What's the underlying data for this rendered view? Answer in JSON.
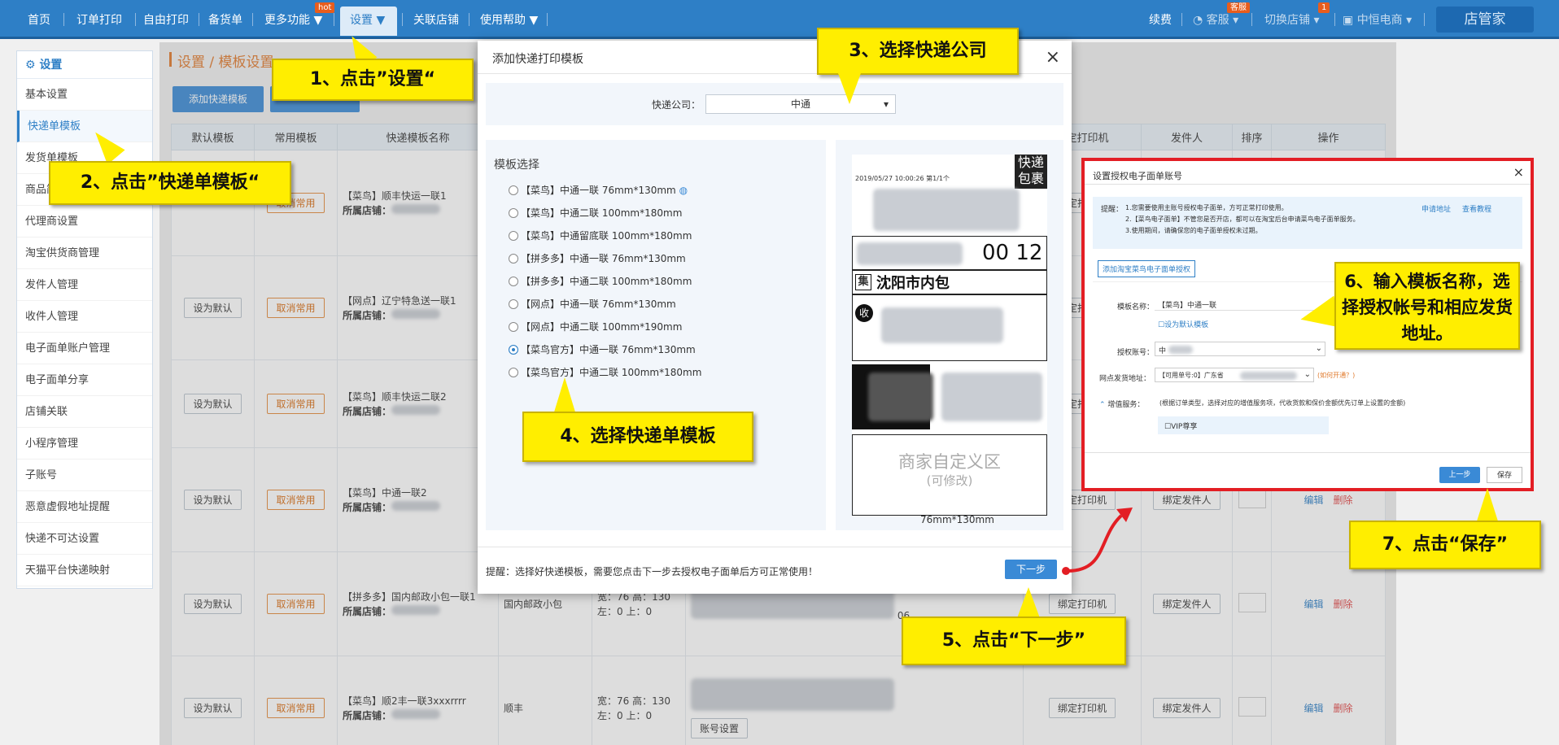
{
  "nav": {
    "items": [
      "首页",
      "订单打印",
      "自由打印",
      "备货单",
      "更多功能 ▼",
      "设置 ▼",
      "关联店铺",
      "使用帮助 ▼"
    ],
    "hot_badge": "hot",
    "right": {
      "renew": "续费",
      "service": "客服",
      "service_badge": "客服",
      "switch_shop": "切换店铺",
      "switch_badge": "1",
      "company": "中恒电商"
    },
    "logo": "店管家"
  },
  "sidebar": {
    "title": "设置",
    "items": [
      "基本设置",
      "快递单模板",
      "发货单模板",
      "商品简称",
      "代理商设置",
      "淘宝供货商管理",
      "发件人管理",
      "收件人管理",
      "电子面单账户管理",
      "电子面单分享",
      "店铺关联",
      "小程序管理",
      "子账号",
      "恶意虚假地址提醒",
      "快递不可达设置",
      "天猫平台快递映射"
    ]
  },
  "main": {
    "crumb": "设置 / 模板设置",
    "add_button": "添加快递模板",
    "table": {
      "headers": [
        "默认模板",
        "常用模板",
        "快递模板名称",
        "",
        "",
        "",
        "绑定打印机",
        "发件人",
        "排序",
        "操作"
      ],
      "shop_label": "所属店铺：",
      "rows": [
        {
          "default": "",
          "common": "取消常用",
          "name": "【菜鸟】顺丰快运一联1",
          "company": "",
          "size": "",
          "bind": ""
        },
        {
          "default": "设为默认",
          "common": "取消常用",
          "name": "【网点】辽宁特急送一联1",
          "company": "",
          "size": "",
          "bind": ""
        },
        {
          "default": "设为默认",
          "common": "取消常用",
          "name": "【菜鸟】顺丰快运二联2",
          "company": "",
          "size": "",
          "bind": ""
        },
        {
          "default": "设为默认",
          "common": "取消常用",
          "name": "【菜鸟】中通一联2",
          "company": "",
          "size": "",
          "bind": ""
        },
        {
          "default": "设为默认",
          "common": "取消常用",
          "name": "【拼多多】国内邮政小包一联1",
          "company": "国内邮政小包",
          "size1": "宽：76 高：130",
          "size2": "左：0 上：0",
          "extra": "06"
        },
        {
          "default": "设为默认",
          "common": "取消常用",
          "name": "【菜鸟】顺2丰一联3xxxrrrr",
          "company": "顺丰",
          "size1": "宽：76 高：130",
          "size2": "左：0 上：0",
          "extra": ""
        }
      ],
      "bind_printer": "绑定打印机",
      "bind_sender": "绑定发件人",
      "edit": "编辑",
      "delete": "删除",
      "account_setting": "账号设置"
    }
  },
  "dialog": {
    "title": "添加快递打印模板",
    "company_label": "快递公司：",
    "company_value": "中通",
    "template_label": "模板选择",
    "options": [
      "【菜鸟】中通一联 76mm*130mm",
      "【菜鸟】中通二联 100mm*180mm",
      "【菜鸟】中通留底联 100mm*180mm",
      "【拼多多】中通一联 76mm*130mm",
      "【拼多多】中通二联 100mm*180mm",
      "【网点】中通一联 76mm*130mm",
      "【网点】中通二联 100mm*190mm",
      "【菜鸟官方】中通一联 76mm*130mm",
      "【菜鸟官方】中通二联 100mm*180mm"
    ],
    "selected_index": 7,
    "preview": {
      "date": "2019/05/27  10:00:26  第1/1个",
      "tag1": "快递",
      "tag2": "包裹",
      "num": "00 12",
      "ji": "集",
      "city": "沈阳市内包",
      "shou": "收",
      "custom": "商家自定义区",
      "custom_sub": "(可修改)",
      "size": "76mm*130mm"
    },
    "tip": "提醒：选择好快递模板，需要您点击下一步去授权电子面单后方可正常使用！",
    "next": "下一步"
  },
  "auth": {
    "title": "设置授权电子面单账号",
    "tip_label": "提醒：",
    "tips": [
      "1.您需要使用主账号授权电子面单，方可正常打印使用。",
      "2.【菜鸟电子面单】不管您是否开店，都可以在淘宝后台申请菜鸟电子面单服务。",
      "3.使用期间，请确保您的电子面单授权未过期。"
    ],
    "apply_link": "申请地址",
    "tutorial_link": "查看教程",
    "add_auth": "添加淘宝菜鸟电子面单授权",
    "name_label": "模板名称：",
    "name_value": "【菜鸟】中通一联",
    "set_default": "设为默认模板",
    "account_label": "授权账号：",
    "account_value": "中",
    "address_label": "网点发货地址：",
    "address_value": "【可用单号:0】广东省",
    "open_link": "(如何开通？)",
    "service_label": "增值服务：",
    "service_desc": "(根据订单类型，选择对应的增值服务项，代收货款和保价金额优先订单上设置的金额)",
    "vip": "VIP尊享",
    "prev": "上一步",
    "save": "保存"
  },
  "callouts": {
    "c1": "1、点击”设置“",
    "c2": "2、点击”快递单模板“",
    "c3": "3、选择快递公司",
    "c4": "4、选择快递单模板",
    "c5": "5、点击“下一步”",
    "c6": "6、输入模板名称，选择授权帐号和相应发货地址。",
    "c7": "7、点击“保存”"
  }
}
